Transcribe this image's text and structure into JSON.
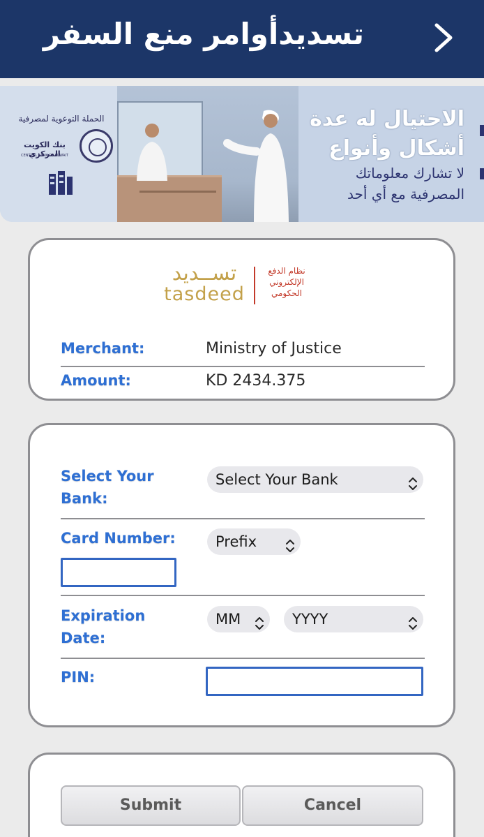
{
  "header": {
    "title": "تسديدأوامر منع السفر",
    "back_icon": "chevron-right-icon",
    "bg_color": "#1c3668"
  },
  "banner": {
    "org_line": "الحملة التوعوية لمصرفية",
    "cbk_ar": "بنك الكويت المركزي",
    "cbk_en": "CENTRAL BANK OF KUWAIT",
    "headline1": "الاحتيال له عدة",
    "headline2": "أشكال وأنواع",
    "subline1": "لا تشارك معلوماتك",
    "subline2": "المصرفية مع أي أحد"
  },
  "logo": {
    "arabic_name": "تســديد",
    "latin_name": "tasdeed",
    "tagline1": "نظام الدفع",
    "tagline2": "الإلكتروني",
    "tagline3": "الحكومي"
  },
  "payment_info": {
    "merchant_label": "Merchant:",
    "merchant_value": "Ministry of Justice",
    "amount_label": "Amount:",
    "amount_value": "KD 2434.375"
  },
  "form": {
    "bank_label_line1": "Select Your",
    "bank_label_line2": "Bank:",
    "bank_select_value": "Select Your Bank",
    "card_label": "Card Number:",
    "prefix_select_value": "Prefix",
    "card_input_value": "",
    "expiry_label_line1": "Expiration",
    "expiry_label_line2": "Date:",
    "month_select_value": "MM",
    "year_select_value": "YYYY",
    "pin_label": "PIN:",
    "pin_input_value": ""
  },
  "actions": {
    "submit_label": "Submit",
    "cancel_label": "Cancel"
  },
  "colors": {
    "label_blue": "#2e6fd3",
    "input_border": "#3366c2",
    "logo_gold": "#c3a14a",
    "logo_red": "#c33a2a"
  }
}
